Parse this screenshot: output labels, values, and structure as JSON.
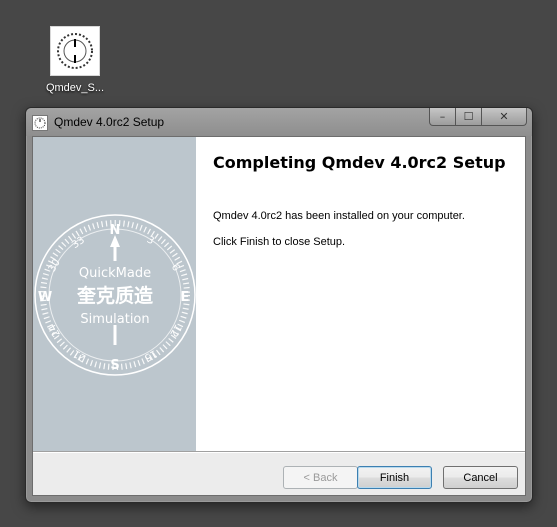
{
  "desktop": {
    "icon_label": "Qmdev_S..."
  },
  "window": {
    "title": "Qmdev 4.0rc2 Setup",
    "controls": {
      "minimize": "–",
      "maximize": "☐",
      "close": "✕"
    }
  },
  "sidebar": {
    "logo": {
      "line1": "QuickMade",
      "line2": "奎克质造",
      "line3": "Simulation",
      "directions": [
        "N",
        "E",
        "S",
        "W"
      ],
      "ticks": [
        "33",
        "3",
        "6",
        "12",
        "15",
        "21",
        "24",
        "30"
      ]
    }
  },
  "page": {
    "heading": "Completing Qmdev 4.0rc2 Setup",
    "line1": "Qmdev 4.0rc2 has been installed on your computer.",
    "line2": "Click Finish to close Setup."
  },
  "buttons": {
    "back": "< Back",
    "finish": "Finish",
    "cancel": "Cancel"
  }
}
